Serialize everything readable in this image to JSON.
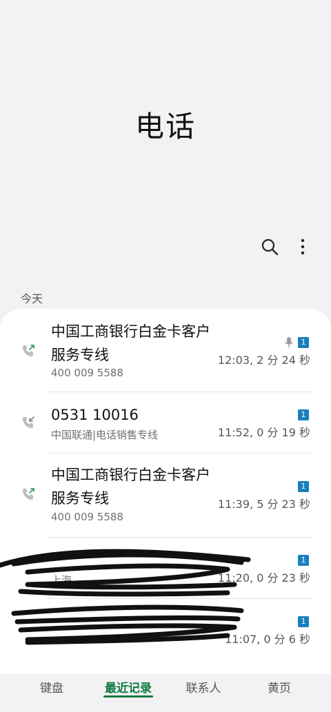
{
  "header": {
    "title": "电话"
  },
  "toolbar": {
    "search_icon": "search-icon",
    "more_icon": "more-vertical-icon"
  },
  "section": {
    "label": "今天"
  },
  "calls": [
    {
      "type": "outgoing",
      "name_line1": "中国工商银行白金卡客户",
      "name_line2": "服务专线",
      "sub": "400 009 5588",
      "time": "12:03, 2 分 24 秒",
      "sim": "1",
      "recorded": true
    },
    {
      "type": "incoming",
      "name_line1": "0531 10016",
      "sub": "中国联通|电话销售专线",
      "time": "11:52, 0 分 19 秒",
      "sim": "1"
    },
    {
      "type": "outgoing",
      "name_line1": "中国工商银行白金卡客户",
      "name_line2": "服务专线",
      "sub": "400 009 5588",
      "time": "11:39, 5 分 23 秒",
      "sim": "1"
    },
    {
      "type": "outgoing",
      "name_line1": "",
      "sub": "上海",
      "time": "11:20, 0 分 23 秒",
      "sim": "1"
    },
    {
      "type": "outgoing",
      "name_line1": "",
      "sub": "",
      "time": "11:07, 0 分 6 秒",
      "sim": "1"
    }
  ],
  "nav": {
    "keypad": "键盘",
    "recents": "最近记录",
    "contacts": "联系人",
    "yellow_pages": "黄页"
  },
  "colors": {
    "accent": "#0c7a3e",
    "sim_badge": "#1a7fbf",
    "call_icon": "#3aa35a"
  }
}
